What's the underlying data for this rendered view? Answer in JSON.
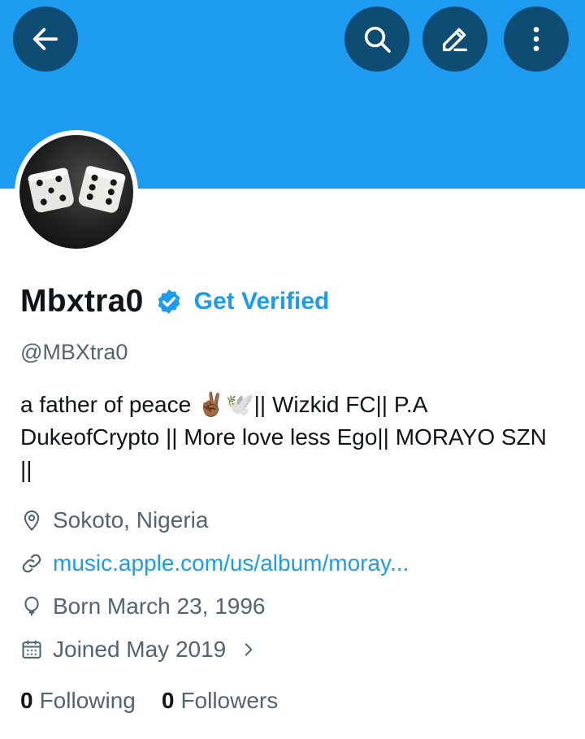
{
  "header": {
    "banner_color": "#1d9bf0",
    "buttons": [
      {
        "name": "back",
        "icon": "arrow-left-icon"
      },
      {
        "name": "search",
        "icon": "search-icon"
      },
      {
        "name": "compose",
        "icon": "pencil-icon"
      },
      {
        "name": "more",
        "icon": "more-vertical-icon"
      }
    ]
  },
  "profile": {
    "avatar": "dice-avatar",
    "display_name": "Mbxtra0",
    "verified_badge": "verified-badge-icon",
    "get_verified_label": "Get Verified",
    "handle": "@MBXtra0",
    "bio": "a father of peace ✌🏾🕊️|| Wizkid FC|| P.A DukeofCrypto || More love less Ego|| MORAYO SZN ||",
    "location": "Sokoto, Nigeria",
    "website": "music.apple.com/us/album/moray...",
    "born": "Born March 23, 1996",
    "joined": "Joined May 2019",
    "following_count": "0",
    "following_label": "Following",
    "followers_count": "0",
    "followers_label": "Followers"
  },
  "colors": {
    "accent": "#1d9bf0",
    "button_bg": "#0f4c73",
    "secondary_text": "#536471"
  }
}
